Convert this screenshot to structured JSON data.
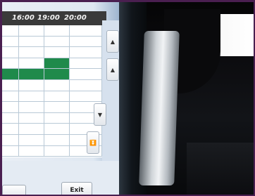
{
  "schedule": {
    "time_labels": [
      "16:00",
      "19:00",
      "20:00"
    ]
  },
  "scroll_buttons": [
    {
      "icon": "up-arrow-icon"
    },
    {
      "icon": "up-arrow-icon"
    },
    {
      "icon": "down-arrow-icon"
    },
    {
      "icon": "double-down-arrow-icon"
    }
  ],
  "footer": {
    "exit_label": "Exit"
  }
}
